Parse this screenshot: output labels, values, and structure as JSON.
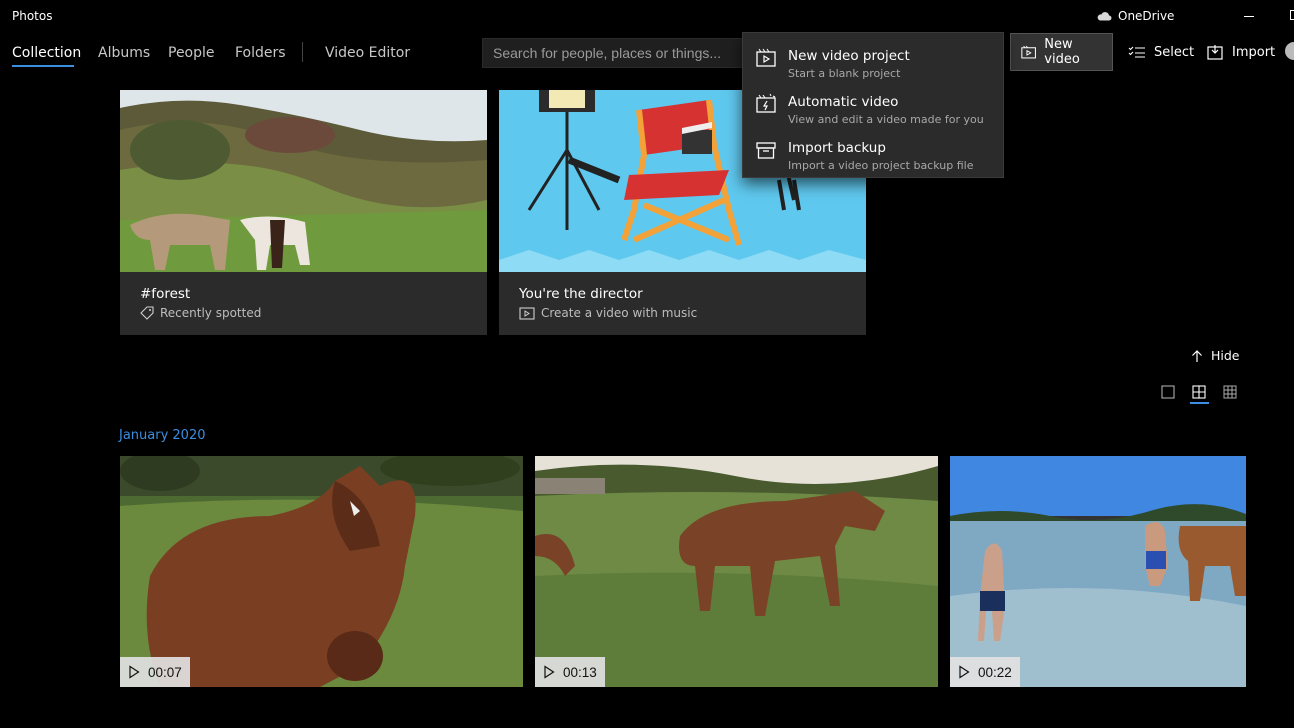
{
  "app": {
    "title": "Photos",
    "onedrive_label": "OneDrive"
  },
  "nav": {
    "tabs": [
      "Collection",
      "Albums",
      "People",
      "Folders",
      "Video Editor"
    ],
    "active": "Collection"
  },
  "search": {
    "placeholder": "Search for people, places or things..."
  },
  "toolbar": {
    "new_video": "New video",
    "select": "Select",
    "import": "Import"
  },
  "new_video_menu": [
    {
      "title": "New video project",
      "subtitle": "Start a blank project",
      "icon": "video-project-icon"
    },
    {
      "title": "Automatic video",
      "subtitle": "View and edit a video made for you",
      "icon": "auto-video-icon"
    },
    {
      "title": "Import backup",
      "subtitle": "Import a video project backup file",
      "icon": "archive-icon"
    }
  ],
  "cards": [
    {
      "title": "#forest",
      "subtitle": "Recently spotted",
      "icon": "tag-icon"
    },
    {
      "title": "You're the director",
      "subtitle": "Create a video with music",
      "icon": "film-icon"
    }
  ],
  "hide_label": "Hide",
  "view_modes": [
    "single",
    "medium-grid",
    "small-grid"
  ],
  "active_view_mode": "medium-grid",
  "section": {
    "date": "January 2020"
  },
  "videos": [
    {
      "duration": "00:07"
    },
    {
      "duration": "00:13"
    },
    {
      "duration": "00:22"
    }
  ],
  "colors": {
    "accent": "#3b8ee0",
    "background": "#000000",
    "card": "#2b2b2b",
    "menu": "#2b2b2b"
  }
}
